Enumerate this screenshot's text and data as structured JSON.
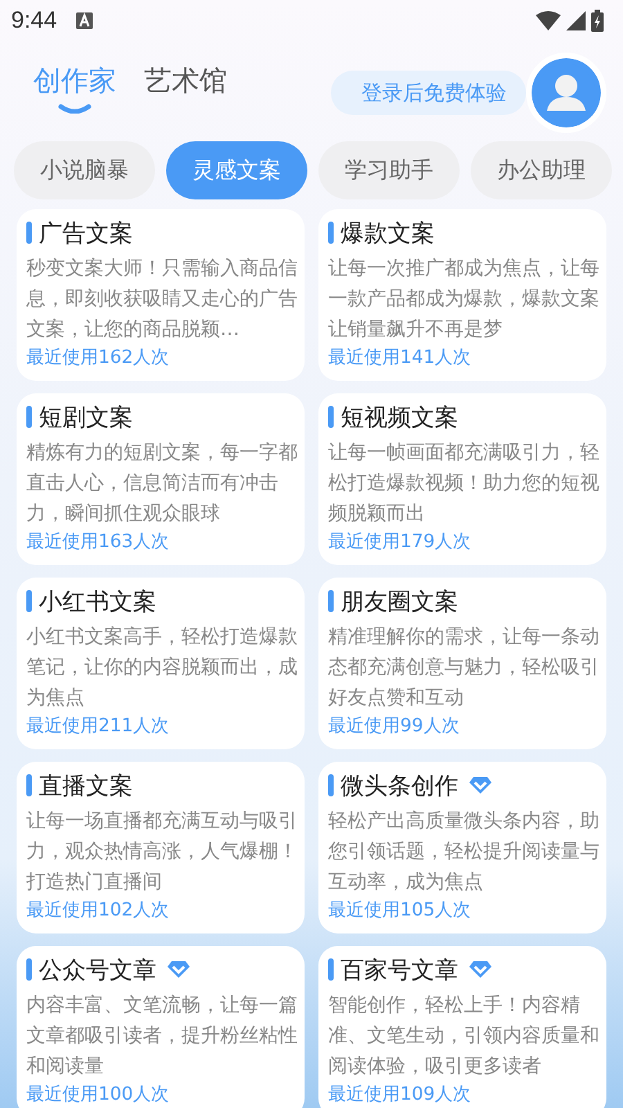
{
  "status_bar": {
    "time": "9:44"
  },
  "top_tabs": [
    {
      "label": "创作家",
      "selected": true
    },
    {
      "label": "艺术馆",
      "selected": false
    }
  ],
  "login_button": "登录后免费体验",
  "categories": [
    {
      "label": "小说脑暴",
      "selected": false
    },
    {
      "label": "灵感文案",
      "selected": true
    },
    {
      "label": "学习助手",
      "selected": false
    },
    {
      "label": "办公助理",
      "selected": false
    }
  ],
  "cards": [
    {
      "title": "广告文案",
      "premium": false,
      "description": "秒变文案大师！只需输入商品信息，即刻收获吸睛又走心的广告文案，让您的商品脱颖…",
      "usage": "最近使用162人次"
    },
    {
      "title": "爆款文案",
      "premium": false,
      "description": "让每一次推广都成为焦点，让每一款产品都成为爆款，爆款文案让销量飙升不再是梦",
      "usage": "最近使用141人次"
    },
    {
      "title": "短剧文案",
      "premium": false,
      "description": "精炼有力的短剧文案，每一字都直击人心，信息简洁而有冲击力，瞬间抓住观众眼球",
      "usage": "最近使用163人次"
    },
    {
      "title": "短视频文案",
      "premium": false,
      "description": "让每一帧画面都充满吸引力，轻松打造爆款视频！助力您的短视频脱颖而出",
      "usage": "最近使用179人次"
    },
    {
      "title": "小红书文案",
      "premium": false,
      "description": "小红书文案高手，轻松打造爆款笔记，让你的内容脱颖而出，成为焦点",
      "usage": "最近使用211人次"
    },
    {
      "title": "朋友圈文案",
      "premium": false,
      "description": "精准理解你的需求，让每一条动态都充满创意与魅力，轻松吸引好友点赞和互动",
      "usage": "最近使用99人次"
    },
    {
      "title": "直播文案",
      "premium": false,
      "description": "让每一场直播都充满互动与吸引力，观众热情高涨，人气爆棚！打造热门直播间",
      "usage": "最近使用102人次"
    },
    {
      "title": "微头条创作",
      "premium": true,
      "description": "轻松产出高质量微头条内容，助您引领话题，轻松提升阅读量与互动率，成为焦点",
      "usage": "最近使用105人次"
    },
    {
      "title": "公众号文章",
      "premium": true,
      "description": "内容丰富、文笔流畅，让每一篇文章都吸引读者，提升粉丝粘性和阅读量",
      "usage": "最近使用100人次"
    },
    {
      "title": "百家号文章",
      "premium": true,
      "description": "智能创作，轻松上手！内容精准、文笔生动，引领内容质量和阅读体验，吸引更多读者",
      "usage": "最近使用109人次"
    }
  ]
}
